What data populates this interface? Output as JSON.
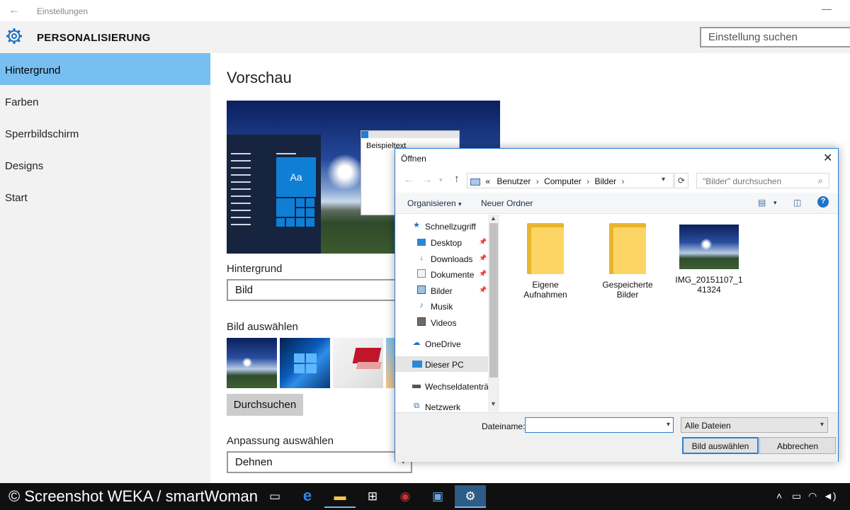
{
  "window": {
    "title": "Einstellungen",
    "back_glyph": "←",
    "minimize_glyph": "—"
  },
  "sidebar": {
    "header": "PERSONALISIERUNG",
    "items": [
      {
        "label": "Hintergrund",
        "active": true
      },
      {
        "label": "Farben"
      },
      {
        "label": "Sperrbildschirm"
      },
      {
        "label": "Designs"
      },
      {
        "label": "Start"
      }
    ]
  },
  "search": {
    "placeholder": "Einstellung suchen"
  },
  "main": {
    "preview_title": "Vorschau",
    "preview": {
      "tile_label": "Aa",
      "window_text": "Beispieltext"
    },
    "background_label": "Hintergrund",
    "background_value": "Bild",
    "choose_picture_label": "Bild auswählen",
    "browse_button": "Durchsuchen",
    "fit_label": "Anpassung auswählen",
    "fit_value": "Dehnen"
  },
  "dialog": {
    "title": "Öffnen",
    "close_glyph": "✕",
    "breadcrumb": {
      "prefix": "«",
      "items": [
        "Benutzer",
        "Computer",
        "Bilder"
      ],
      "separator": "›"
    },
    "search_placeholder": "\"Bilder\" durchsuchen",
    "toolbar": {
      "organize": "Organisieren",
      "new_folder": "Neuer Ordner",
      "help": "?"
    },
    "nav": [
      {
        "label": "Schnellzugriff",
        "icon": "star-icon",
        "level": 0
      },
      {
        "label": "Desktop",
        "icon": "desktop-icon",
        "level": 1,
        "pinned": true
      },
      {
        "label": "Downloads",
        "icon": "download-arrow-icon",
        "level": 1,
        "pinned": true
      },
      {
        "label": "Dokumente",
        "icon": "document-icon",
        "level": 1,
        "pinned": true
      },
      {
        "label": "Bilder",
        "icon": "pictures-icon",
        "level": 1,
        "pinned": true
      },
      {
        "label": "Musik",
        "icon": "music-note-icon",
        "level": 1
      },
      {
        "label": "Videos",
        "icon": "film-icon",
        "level": 1
      },
      {
        "label": "OneDrive",
        "icon": "cloud-icon",
        "level": 0
      },
      {
        "label": "Dieser PC",
        "icon": "computer-icon",
        "level": 0,
        "selected": true
      },
      {
        "label": "Wechseldatenträg",
        "icon": "drive-icon",
        "level": 0
      },
      {
        "label": "Netzwerk",
        "icon": "network-icon",
        "level": 0
      }
    ],
    "files": [
      {
        "name": "Eigene Aufnahmen",
        "type": "folder"
      },
      {
        "name": "Gespeicherte Bilder",
        "type": "folder"
      },
      {
        "name": "IMG_20151107_141324",
        "type": "image"
      }
    ],
    "filename_label": "Dateiname:",
    "filename_value": "",
    "filetype_value": "Alle Dateien",
    "select_button": "Bild auswählen",
    "cancel_button": "Abbrechen"
  },
  "taskbar": {
    "credit": "© Screenshot WEKA / smartWoman",
    "colors": {
      "bg": "#101010",
      "active": "#2d5c86"
    }
  },
  "colors": {
    "accent": "#0078d7",
    "sidebar_active": "#77bff0"
  }
}
